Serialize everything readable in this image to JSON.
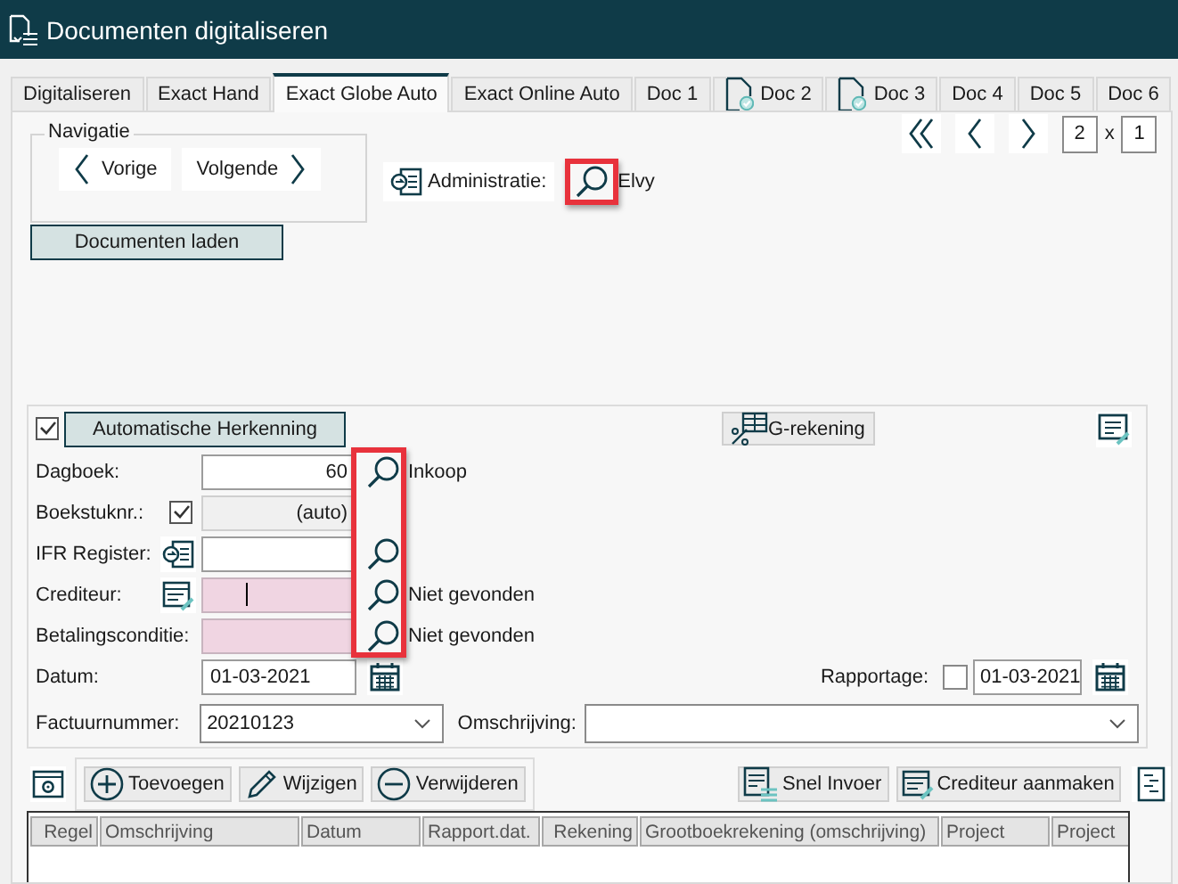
{
  "window": {
    "title": "Documenten digitaliseren"
  },
  "tabs": [
    {
      "label": "Digitaliseren",
      "selected": false,
      "status_icon": false
    },
    {
      "label": "Exact Hand",
      "selected": false,
      "status_icon": false
    },
    {
      "label": "Exact Globe Auto",
      "selected": true,
      "status_icon": false
    },
    {
      "label": "Exact Online Auto",
      "selected": false,
      "status_icon": false
    },
    {
      "label": "Doc 1",
      "selected": false,
      "status_icon": false
    },
    {
      "label": "Doc 2",
      "selected": false,
      "status_icon": true
    },
    {
      "label": "Doc 3",
      "selected": false,
      "status_icon": true
    },
    {
      "label": "Doc 4",
      "selected": false,
      "status_icon": false
    },
    {
      "label": "Doc 5",
      "selected": false,
      "status_icon": false
    },
    {
      "label": "Doc 6",
      "selected": false,
      "status_icon": false
    }
  ],
  "navigation": {
    "title": "Navigatie",
    "buttons": [
      {
        "label": "Vorige",
        "kind": "prev"
      },
      {
        "label": "Volgende",
        "kind": "next"
      }
    ]
  },
  "pager": {
    "page": "2",
    "separator": "x",
    "total": "1"
  },
  "administratie": {
    "label": "Administratie:",
    "value": "Elvy",
    "lookup_highlighted": true
  },
  "field_lookups_highlighted": true,
  "load_button": "Documenten laden",
  "recognition": {
    "checked": true,
    "label": "Automatische Herkenning"
  },
  "g_account_button": "G-rekening",
  "fields": [
    {
      "kind": "plain",
      "label": "Dagboek:",
      "value": "60",
      "lookup": true,
      "note": "Inkoop",
      "invalid": false,
      "focused": false
    },
    {
      "kind": "auto",
      "label": "Boekstuknr.:",
      "checked": true,
      "value": "(auto)",
      "lookup": false,
      "invalid": false,
      "focused": false
    },
    {
      "kind": "register",
      "label": "IFR Register:",
      "lookup": true,
      "invalid": false,
      "focused": false
    },
    {
      "kind": "creditor",
      "label": "Crediteur:",
      "lookup": true,
      "note": "Niet gevonden",
      "invalid": true,
      "focused": true
    },
    {
      "kind": "plain",
      "label": "Betalingsconditie:",
      "lookup": true,
      "note": "Niet gevonden",
      "invalid": true,
      "focused": false
    }
  ],
  "date": {
    "label": "Datum:",
    "value": "01-03-2021"
  },
  "reporting": {
    "label": "Rapportage:",
    "checked": false,
    "value": "01-03-2021"
  },
  "invoice": {
    "label": "Factuurnummer:",
    "value": "20210123"
  },
  "description": {
    "label": "Omschrijving:"
  },
  "toolbar": {
    "left": [
      {
        "label": "Toevoegen",
        "kind": "add"
      },
      {
        "label": "Wijzigen",
        "kind": "edit"
      },
      {
        "label": "Verwijderen",
        "kind": "remove"
      }
    ],
    "right": [
      {
        "label": "Snel Invoer",
        "kind": "quick"
      },
      {
        "label": "Crediteur aanmaken",
        "kind": "creditor"
      }
    ]
  },
  "table": {
    "columns": [
      "Regel",
      "Omschrijving",
      "Datum",
      "Rapport.dat.",
      "Rekening",
      "Grootboekrekening (omschrijving)",
      "Project",
      "Project"
    ]
  }
}
